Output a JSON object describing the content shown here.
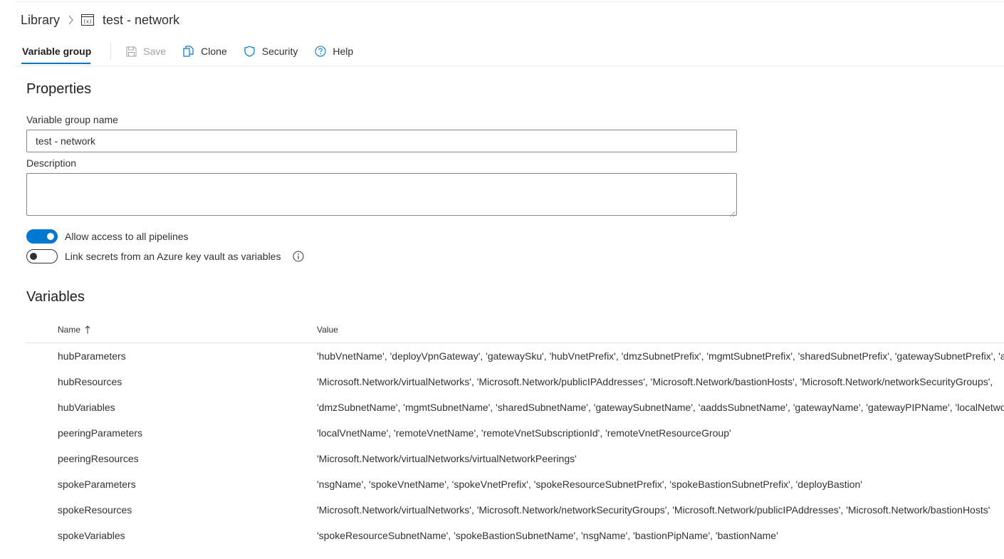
{
  "breadcrumb": {
    "library": "Library",
    "current": "test - network"
  },
  "toolbar": {
    "tab_label": "Variable group",
    "save": "Save",
    "clone": "Clone",
    "security": "Security",
    "help": "Help"
  },
  "properties": {
    "title": "Properties",
    "name_label": "Variable group name",
    "name_value": "test - network",
    "description_label": "Description",
    "description_value": "",
    "allow_access_label": "Allow access to all pipelines",
    "allow_access_on": true,
    "link_secrets_label": "Link secrets from an Azure key vault as variables",
    "link_secrets_on": false
  },
  "variables": {
    "title": "Variables",
    "header_name": "Name",
    "header_value": "Value",
    "rows": [
      {
        "name": "hubParameters",
        "value": "'hubVnetName', 'deployVpnGateway', 'gatewaySku', 'hubVnetPrefix', 'dmzSubnetPrefix', 'mgmtSubnetPrefix', 'sharedSubnetPrefix', 'gatewaySubnetPrefix', 'aadd"
      },
      {
        "name": "hubResources",
        "value": "'Microsoft.Network/virtualNetworks', 'Microsoft.Network/publicIPAddresses', 'Microsoft.Network/bastionHosts', 'Microsoft.Network/networkSecurityGroups',"
      },
      {
        "name": "hubVariables",
        "value": "'dmzSubnetName', 'mgmtSubnetName', 'sharedSubnetName', 'gatewaySubnetName', 'aaddsSubnetName', 'gatewayName', 'gatewayPIPName', 'localNetwork"
      },
      {
        "name": "peeringParameters",
        "value": "'localVnetName', 'remoteVnetName', 'remoteVnetSubscriptionId', 'remoteVnetResourceGroup'"
      },
      {
        "name": "peeringResources",
        "value": "'Microsoft.Network/virtualNetworks/virtualNetworkPeerings'"
      },
      {
        "name": "spokeParameters",
        "value": "'nsgName', 'spokeVnetName', 'spokeVnetPrefix', 'spokeResourceSubnetPrefix', 'spokeBastionSubnetPrefix', 'deployBastion'"
      },
      {
        "name": "spokeResources",
        "value": "'Microsoft.Network/virtualNetworks', 'Microsoft.Network/networkSecurityGroups', 'Microsoft.Network/publicIPAddresses', 'Microsoft.Network/bastionHosts'"
      },
      {
        "name": "spokeVariables",
        "value": "'spokeResourceSubnetName', 'spokeBastionSubnetName', 'nsgName', 'bastionPipName', 'bastionName'"
      }
    ]
  },
  "colors": {
    "accent": "#0078d4",
    "text": "#323130",
    "disabled": "#a19f9d"
  }
}
